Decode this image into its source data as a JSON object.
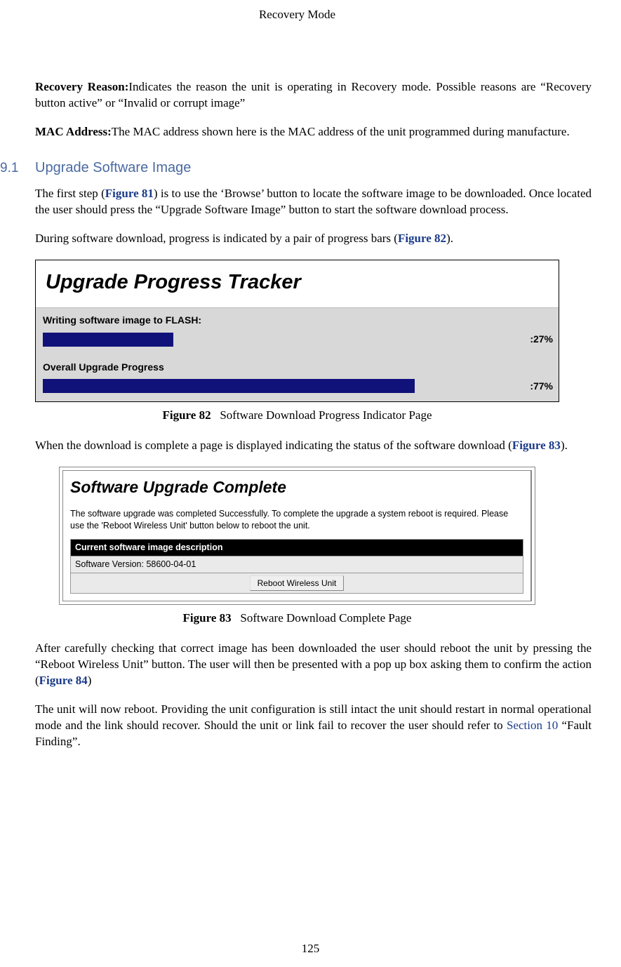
{
  "header": {
    "running": "Recovery Mode"
  },
  "defs": {
    "recovery_reason_label": "Recovery Reason:",
    "recovery_reason_text": "Indicates the reason the unit is operating in Recovery mode. Possible reasons are “Recovery button active” or “Invalid or corrupt image”",
    "mac_label": "MAC Address:",
    "mac_text": "The MAC address shown here is the MAC address of the unit programmed during manufacture."
  },
  "section": {
    "num": "9.1",
    "title": "Upgrade Software Image",
    "p1a": "The first step (",
    "p1_ref": "Figure 81",
    "p1b": ") is to use the ‘Browse’ button to locate the software image to be downloaded.  Once located the user should press the “Upgrade Software Image” button to start the software download process.",
    "p2a": "During software download, progress is indicated by a pair of progress bars (",
    "p2_ref": "Figure 82",
    "p2b": ")."
  },
  "fig82": {
    "title": "Upgrade Progress Tracker",
    "row1_label": "Writing software image to FLASH:",
    "row1_pct": ":27%",
    "row1_fill": 27,
    "row2_label": "Overall Upgrade Progress",
    "row2_pct": ":77%",
    "row2_fill": 77,
    "caption_strong": "Figure 82",
    "caption_rest": "Software Download Progress Indicator Page"
  },
  "mid": {
    "p3a": "When the download is complete a page is displayed indicating the status of the software download (",
    "p3_ref": "Figure 83",
    "p3b": ")."
  },
  "fig83": {
    "title": "Software Upgrade Complete",
    "msg": "The software upgrade was completed Successfully. To complete the upgrade a system reboot is required. Please use the 'Reboot Wireless Unit' button below to reboot the unit.",
    "desc_head": "Current software image description",
    "version": "Software Version: 58600-04-01",
    "button": "Reboot Wireless Unit",
    "caption_strong": "Figure 83",
    "caption_rest": "Software Download Complete Page"
  },
  "tail": {
    "p4a": "After carefully checking that correct image has been downloaded the user should reboot the unit by pressing the “Reboot Wireless Unit” button.  The user will then be presented with a pop up box asking them to confirm the action (",
    "p4_ref": "Figure 84",
    "p4b": ")",
    "p5a": "The unit will now reboot. Providing the unit configuration is still intact the unit should restart in normal operational mode and the link should recover. Should the unit or link fail to recover the user should refer to ",
    "p5_ref": "Section 10",
    "p5b": " “Fault Finding”."
  },
  "page_number": "125"
}
